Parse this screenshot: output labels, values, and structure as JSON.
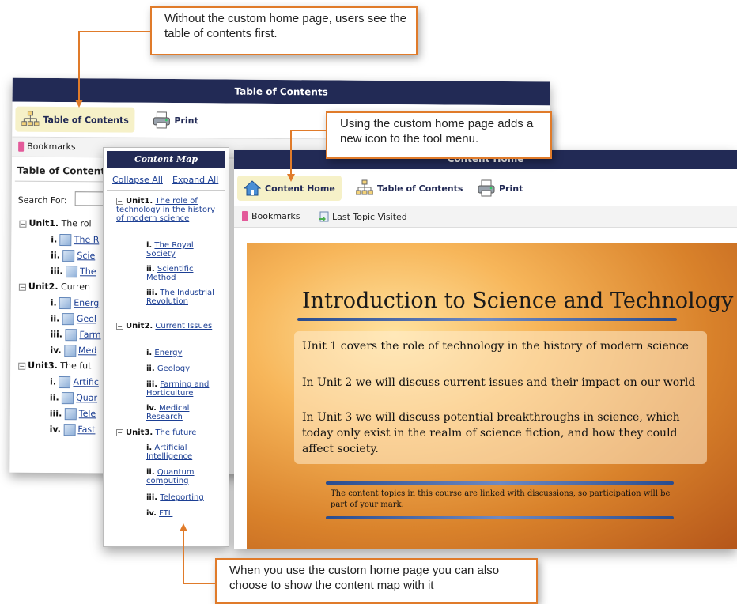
{
  "callouts": {
    "top": "Without the custom home page, users see the table of contents first.",
    "middle": "Using the custom home page adds a new icon to the tool menu.",
    "bottom": "When you use the custom home page you can also choose to show the content map with it"
  },
  "toc_window": {
    "header_title": "Table of Contents",
    "toolbar": {
      "toc_label": "Table of Contents",
      "print_label": "Print"
    },
    "subbar": {
      "bookmarks_label": "Bookmarks"
    },
    "panel_title": "Table of Contents",
    "search_label": "Search For:",
    "tree": [
      {
        "num": "Unit1.",
        "text": "The rol"
      },
      {
        "num": "i.",
        "text": "The R"
      },
      {
        "num": "ii.",
        "text": "Scie"
      },
      {
        "num": "iii.",
        "text": "The"
      },
      {
        "num": "Unit2.",
        "text": "Curren"
      },
      {
        "num": "i.",
        "text": "Energ"
      },
      {
        "num": "ii.",
        "text": "Geol"
      },
      {
        "num": "iii.",
        "text": "Farm"
      },
      {
        "num": "iv.",
        "text": "Med"
      },
      {
        "num": "Unit3.",
        "text": "The fut"
      },
      {
        "num": "i.",
        "text": "Artific"
      },
      {
        "num": "ii.",
        "text": "Quar"
      },
      {
        "num": "iii.",
        "text": "Tele"
      },
      {
        "num": "iv.",
        "text": "Fast"
      }
    ]
  },
  "content_map": {
    "title": "Content Map",
    "collapse_label": "Collapse All",
    "expand_label": "Expand All",
    "items": [
      {
        "num": "Unit1.",
        "text": "The role of technology in the history of modern science"
      },
      {
        "num": "i.",
        "text": "The Royal Society"
      },
      {
        "num": "ii.",
        "text": "Scientific Method"
      },
      {
        "num": "iii.",
        "text": "The Industrial Revolution"
      },
      {
        "num": "Unit2.",
        "text": "Current Issues"
      },
      {
        "num": "i.",
        "text": "Energy"
      },
      {
        "num": "ii.",
        "text": "Geology"
      },
      {
        "num": "iii.",
        "text": "Farming and Horticulture"
      },
      {
        "num": "iv.",
        "text": "Medical Research"
      },
      {
        "num": "Unit3.",
        "text": "The future"
      },
      {
        "num": "i.",
        "text": "Artificial Intelligence"
      },
      {
        "num": "ii.",
        "text": "Quantum computing"
      },
      {
        "num": "iii.",
        "text": "Teleporting"
      },
      {
        "num": "iv.",
        "text": "FTL"
      }
    ]
  },
  "home_window": {
    "header_title": "Content Home",
    "toolbar": {
      "home_label": "Content Home",
      "toc_label": "Table of Contents",
      "print_label": "Print"
    },
    "subbar": {
      "bookmarks_label": "Bookmarks",
      "last_topic_label": "Last Topic Visited"
    },
    "slide": {
      "title": "Introduction to Science and Technology",
      "para1": "Unit 1 covers the role of technology in the history of modern science",
      "para2": "In Unit 2 we will discuss current issues and their impact on our world",
      "para3": "In Unit 3 we will discuss potential breakthroughs in science, which today only exist in the realm of science fiction, and how they could affect society.",
      "note": "The content topics in this course are linked with discussions, so participation will be part of your mark."
    }
  },
  "colors": {
    "accent": "#e07b2a",
    "navy": "#222a55",
    "link": "#1c3f94",
    "slide_orange": "#d9822b"
  }
}
